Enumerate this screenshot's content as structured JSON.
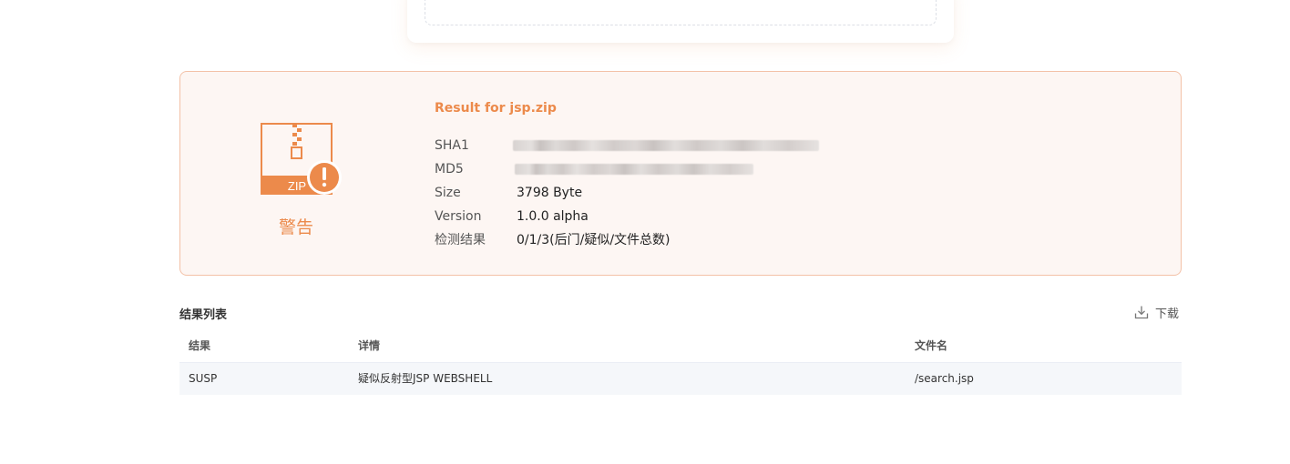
{
  "result": {
    "title": "Result for jsp.zip",
    "status": "警告",
    "icon_text": "ZIP",
    "fields": [
      {
        "key": "SHA1",
        "value": ""
      },
      {
        "key": "MD5",
        "value": ""
      },
      {
        "key": "Size",
        "value": "3798 Byte"
      },
      {
        "key": "Version",
        "value": "1.0.0 alpha"
      },
      {
        "key": "检测结果",
        "value": "0/1/3(后门/疑似/文件总数)"
      }
    ]
  },
  "results_list": {
    "title": "结果列表",
    "download_label": "下载",
    "columns": [
      "结果",
      "详情",
      "文件名"
    ],
    "rows": [
      {
        "result": "SUSP",
        "detail": "疑似反射型JSP WEBSHELL",
        "filename": "/search.jsp"
      }
    ]
  },
  "colors": {
    "accent": "#ec8a4b",
    "panel_background": "#fdf6f3",
    "panel_border": "#f3c1a7",
    "row_background": "#f5f7fa"
  },
  "icons": [
    "zip-file-icon",
    "warning-icon",
    "download-icon"
  ]
}
